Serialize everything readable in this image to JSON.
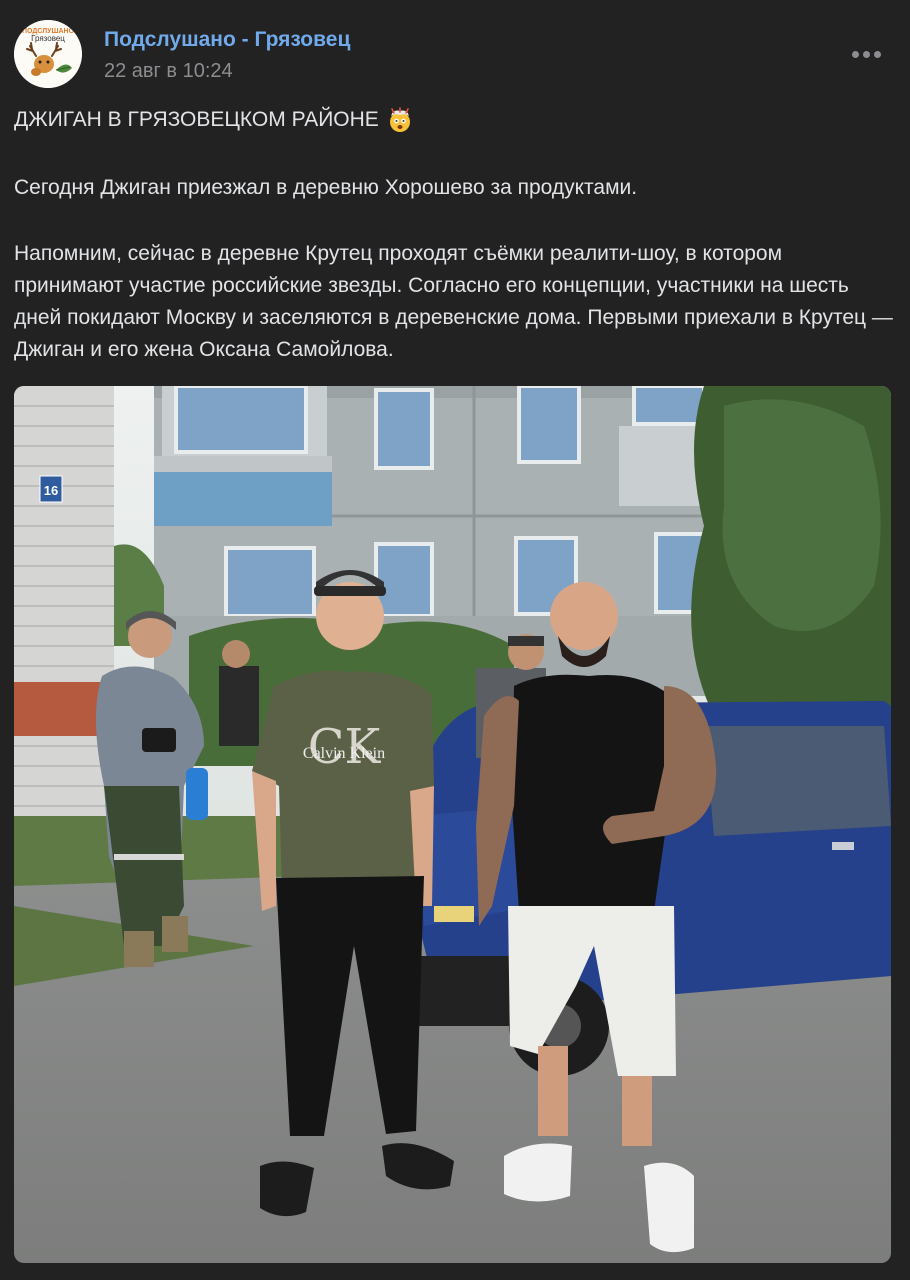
{
  "post": {
    "author": "Подслушано - Грязовец",
    "date": "22 авг в 10:24",
    "avatar": {
      "icon": "deer-logo-icon",
      "caption_top": "ПОДСЛУШАНО",
      "caption_bottom": "Грязовец"
    },
    "headline": "ДЖИГАН В ГРЯЗОВЕЦКОМ РАЙОНЕ",
    "headline_emoji": "exploding-head-emoji",
    "paragraph_1": "Сегодня Джиган приезжал в деревню Хорошево за продуктами.",
    "paragraph_2": "Напомним, сейчас в деревне Крутец проходят съёмки реалити-шоу, в котором принимают участие российские звезды. Согласно его концепции, участники на шесть дней покидают Москву и заселяются в деревенские дома. Первыми приехали в Крутец — Джиган и его жена Оксана Самойлова.",
    "photo": {
      "house_number": "16",
      "shirt_print": "Calvin Klein"
    }
  },
  "colors": {
    "background": "#222222",
    "author_link": "#71aaeb",
    "secondary_text": "#8b8d91",
    "primary_text": "#e1e3e6"
  }
}
